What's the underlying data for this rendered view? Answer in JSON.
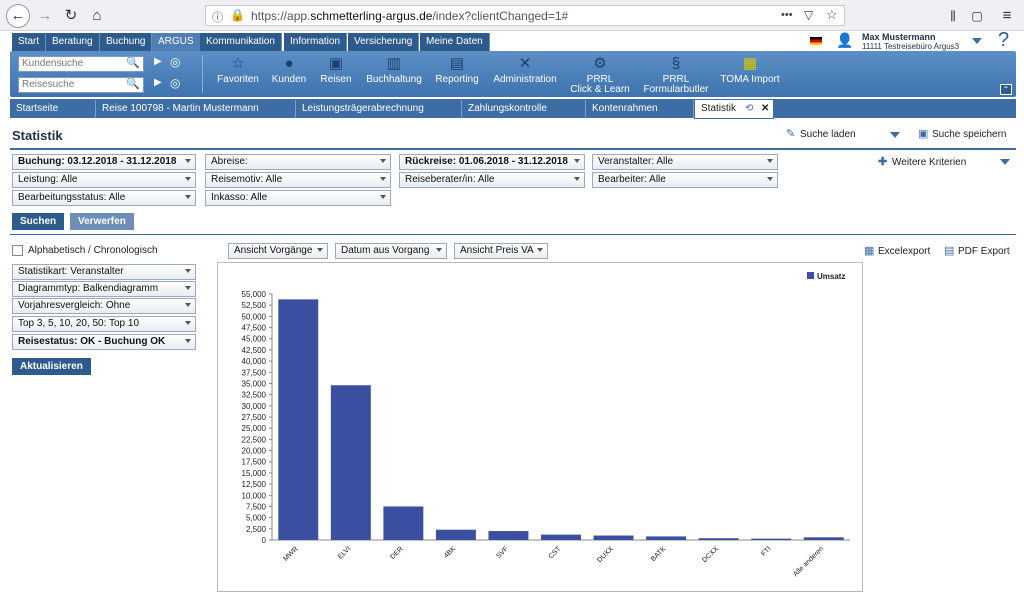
{
  "browser": {
    "url_prefix": "https://app.",
    "url_domain": "schmetterling-argus.de",
    "url_path": "/index?clientChanged=1#",
    "menu_dots": "•••"
  },
  "user": {
    "name": "Max Mustermann",
    "agency": "11111 Testreisebüro Argus3",
    "help": "?"
  },
  "nav": [
    "Start",
    "Beratung",
    "Buchung",
    "ARGUS",
    "Kommunikation",
    "Information",
    "Versicherung",
    "Meine Daten"
  ],
  "search": {
    "kunden": "Kundensuche",
    "reise": "Reisesuche"
  },
  "tools": [
    {
      "label": "Favoriten",
      "icon": "star-icon",
      "glyph": "☆"
    },
    {
      "label": "Kunden",
      "icon": "user-icon",
      "glyph": "👤"
    },
    {
      "label": "Reisen",
      "icon": "suitcase-icon",
      "glyph": "▣"
    },
    {
      "label": "Buchhaltung",
      "icon": "book-icon",
      "glyph": "📖"
    },
    {
      "label": "Reporting",
      "icon": "chart-icon",
      "glyph": "▤"
    },
    {
      "label": "Administration",
      "icon": "tools-icon",
      "glyph": "✕"
    },
    {
      "label": "PRRL",
      "label2": "Click & Learn",
      "icon": "learn-icon",
      "glyph": "⚙"
    },
    {
      "label": "PRRL",
      "label2": "Formularbutler",
      "icon": "form-icon",
      "glyph": "§"
    },
    {
      "label": "TOMA Import",
      "icon": "import-icon",
      "glyph": "▦"
    }
  ],
  "page_tabs": [
    "Startseite",
    "Reise 100798 - Martin Mustermann",
    "Leistungsträgerabrechnung",
    "Zahlungskontrolle",
    "Kontenrahmen",
    "Statistik"
  ],
  "title": "Statistik",
  "actions": {
    "load": "Suche laden",
    "save": "Suche speichern",
    "more": "Weitere Kriterien",
    "excel": "Excelexport",
    "pdf": "PDF Export"
  },
  "filters": {
    "buchung": "Buchung: 03.12.2018 - 31.12.2018",
    "abreise": "Abreise:",
    "rueckreise": "Rückreise: 01.06.2018 - 31.12.2018",
    "veranstalter": "Veranstalter: Alle",
    "leistung": "Leistung: Alle",
    "reisemotiv": "Reisemotiv: Alle",
    "berater": "Reiseberater/in: Alle",
    "bearbeiter": "Bearbeiter: Alle",
    "status": "Bearbeitungsstatus: Alle",
    "inkasso": "Inkasso: Alle"
  },
  "buttons": {
    "search": "Suchen",
    "discard": "Verwerfen",
    "update": "Aktualisieren"
  },
  "options": {
    "sort": "Alphabetisch / Chronologisch",
    "statistikart": "Statistikart: Veranstalter",
    "diagrammtyp": "Diagrammtyp: Balkendiagramm",
    "vorjahr": "Vorjahresvergleich: Ohne",
    "top": "Top 3, 5, 10, 20, 50: Top 10",
    "reisestatus": "Reisestatus: OK - Buchung OK"
  },
  "view": {
    "ansicht": "Ansicht Vorgänge",
    "datum": "Datum aus Vorgang",
    "preis": "Ansicht Preis VA"
  },
  "colors": {
    "bar": "#3a4fa0",
    "accent": "#3e6da6"
  },
  "chart_data": {
    "type": "bar",
    "categories": [
      "MWR",
      "ELVI",
      "DER",
      "4BK",
      "SVF",
      "CST",
      "DUXX",
      "BATK",
      "DCXX",
      "FTI",
      "Alle anderen"
    ],
    "series": [
      {
        "name": "Umsatz",
        "values": [
          53800,
          34600,
          7500,
          2300,
          2000,
          1200,
          1000,
          800,
          400,
          300,
          600
        ]
      }
    ],
    "ylim": [
      0,
      55000
    ],
    "yticks": [
      "0",
      "2,500",
      "5,000",
      "7,500",
      "10,000",
      "12,500",
      "15,000",
      "17,500",
      "20,000",
      "22,500",
      "25,000",
      "27,500",
      "30,000",
      "32,500",
      "35,000",
      "37,500",
      "40,000",
      "42,500",
      "45,000",
      "47,500",
      "50,000",
      "52,500",
      "55,000"
    ],
    "legend": "top-right"
  }
}
